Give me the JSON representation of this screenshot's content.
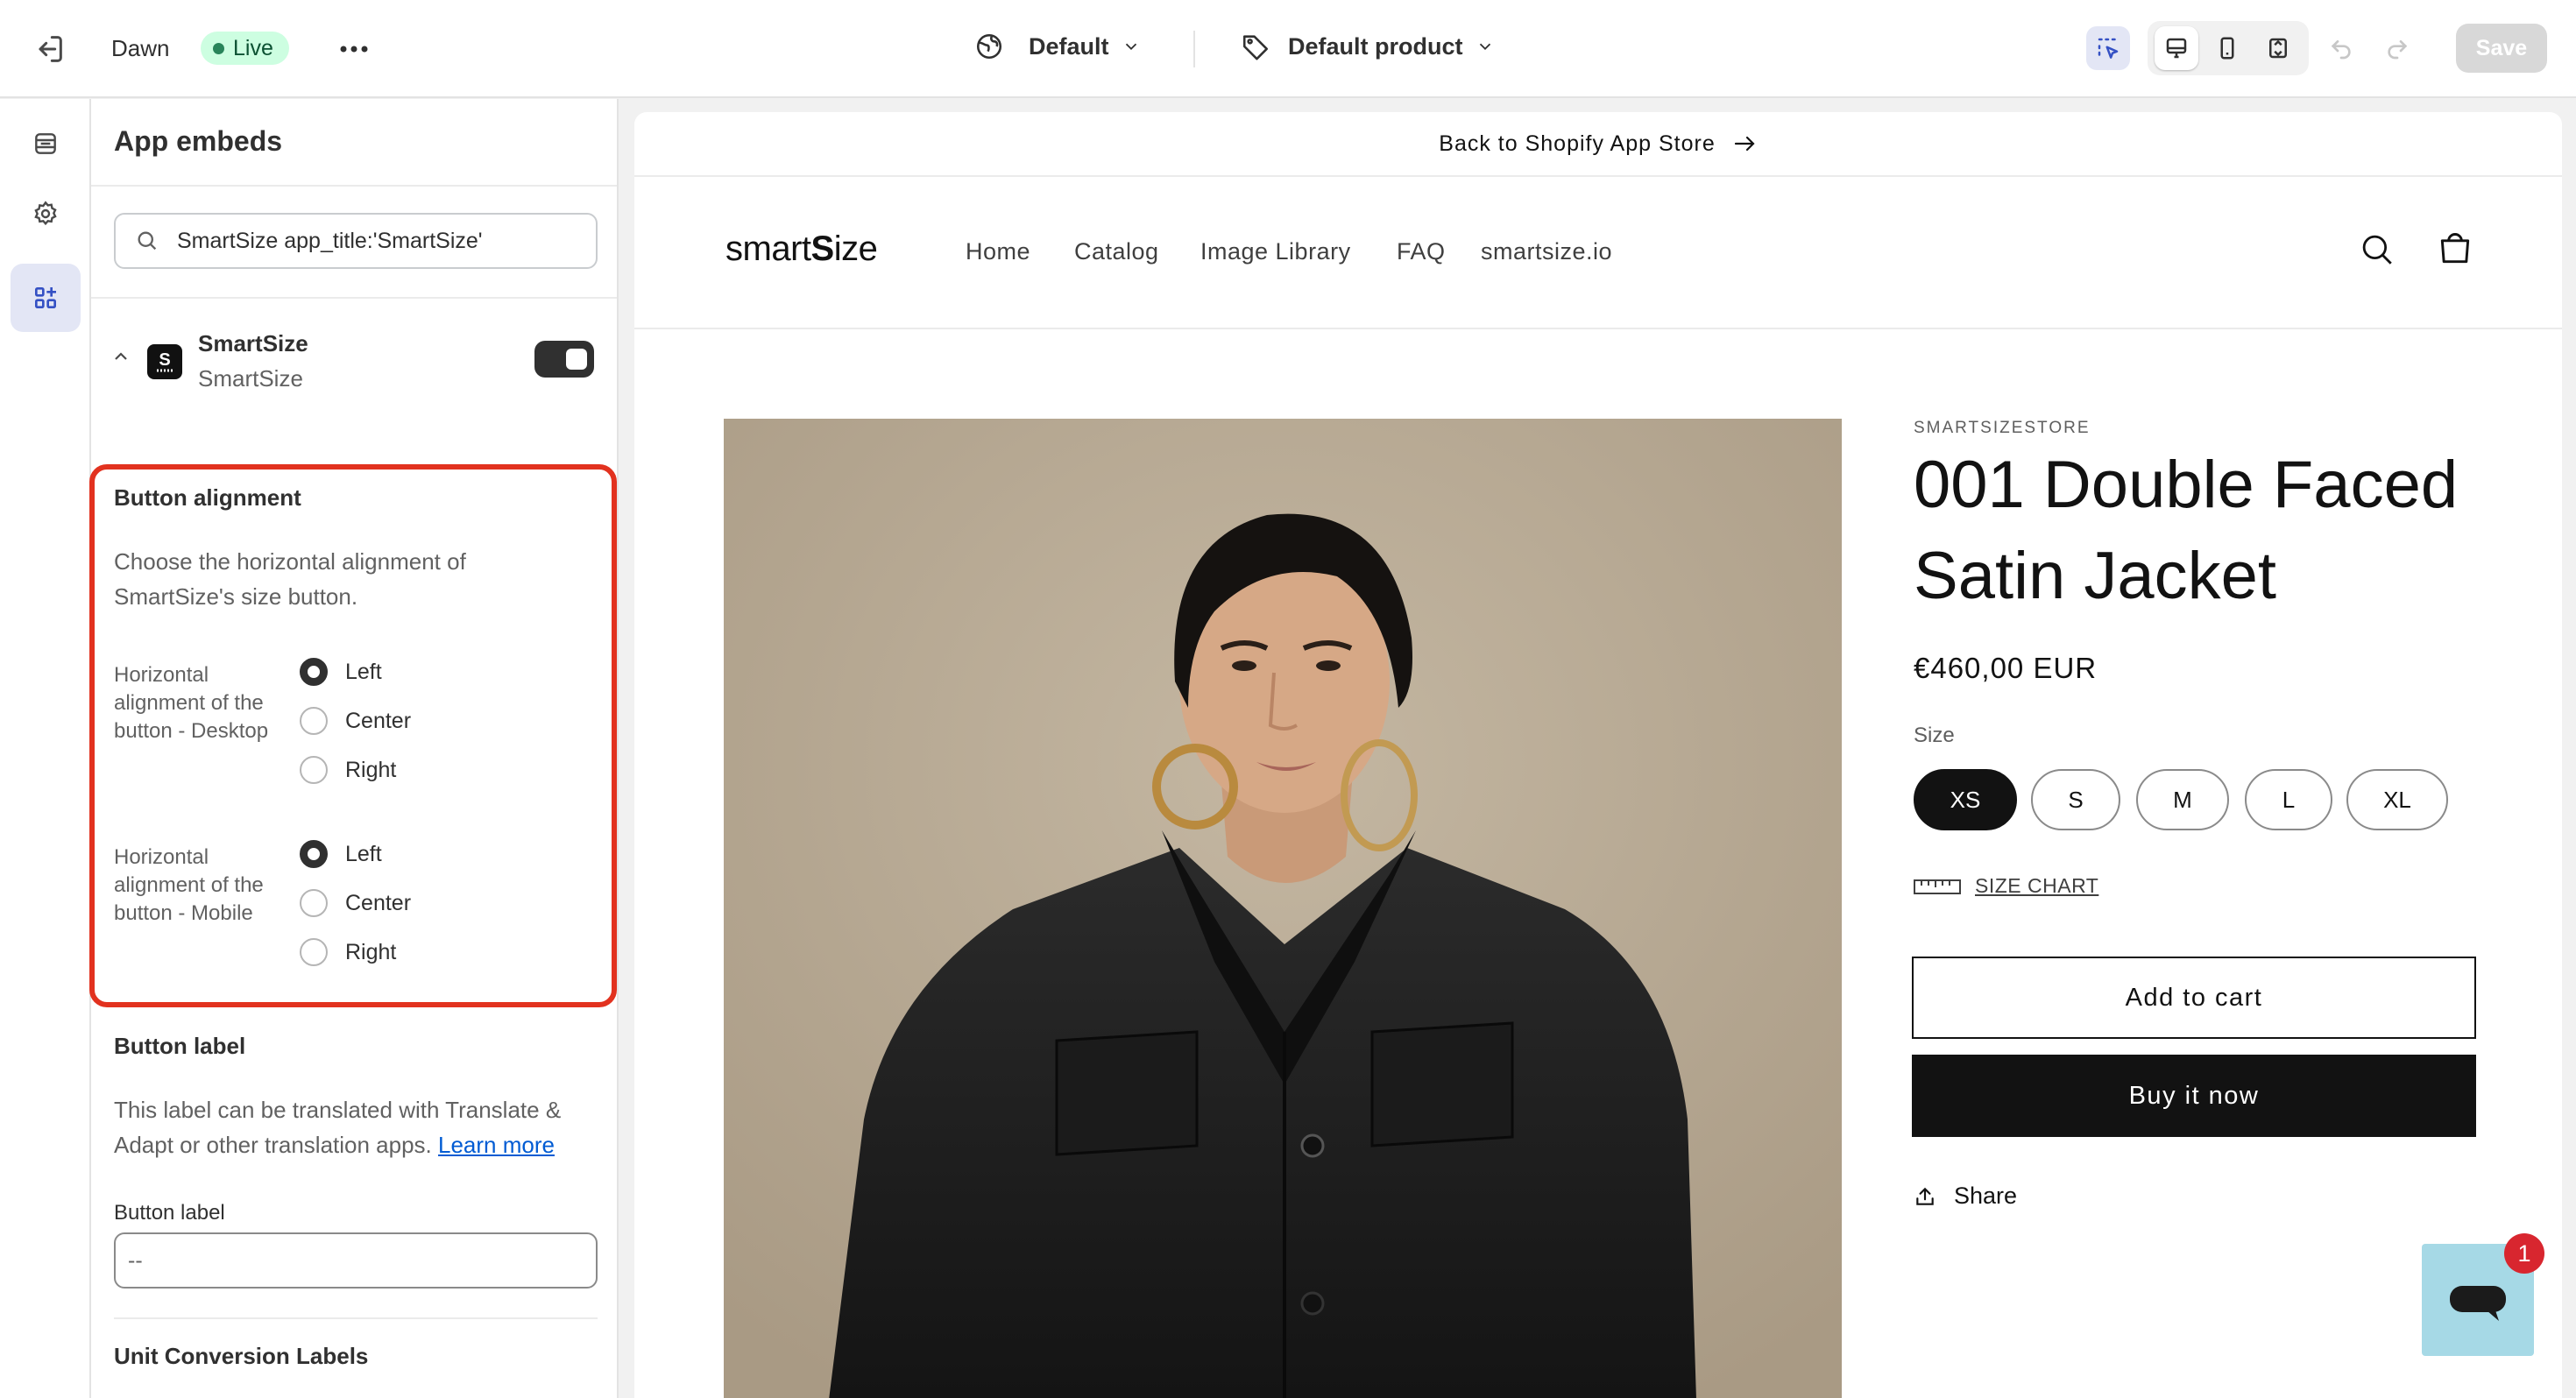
{
  "topbar": {
    "theme_name": "Dawn",
    "live_badge": "Live",
    "more_icon": "ellipsis-icon",
    "template_select": "Default",
    "product_select": "Default product",
    "save_label": "Save"
  },
  "sidebar": {
    "title": "App embeds",
    "search_value": "SmartSize app_title:'SmartSize'",
    "app": {
      "name": "SmartSize",
      "provider": "SmartSize",
      "enabled": true
    },
    "button_alignment": {
      "title": "Button alignment",
      "description": "Choose the horizontal alignment of SmartSize's size button.",
      "desktop": {
        "label": "Horizontal alignment of the button - Desktop",
        "options": [
          "Left",
          "Center",
          "Right"
        ],
        "selected": "Left"
      },
      "mobile": {
        "label": "Horizontal alignment of the button - Mobile",
        "options": [
          "Left",
          "Center",
          "Right"
        ],
        "selected": "Left"
      }
    },
    "button_label": {
      "title": "Button label",
      "description": "This label can be translated with Translate & Adapt or other translation apps.",
      "learn_more": "Learn more",
      "field_label": "Button label",
      "field_value": "--"
    },
    "unit_conversion_title": "Unit Conversion Labels"
  },
  "preview": {
    "announcement": "Back to Shopify App Store",
    "logo": {
      "prefix": "smart",
      "bold": "S",
      "suffix": "ize"
    },
    "nav": [
      "Home",
      "Catalog",
      "Image Library",
      "FAQ",
      "smartsize.io"
    ],
    "product": {
      "vendor": "SMARTSIZESTORE",
      "title": "001 Double Faced Satin Jacket",
      "price": "€460,00 EUR",
      "size_label": "Size",
      "sizes": [
        "XS",
        "S",
        "M",
        "L",
        "XL"
      ],
      "selected_size": "XS",
      "size_chart": "SIZE CHART",
      "add_to_cart": "Add to cart",
      "buy_now": "Buy it now",
      "share": "Share"
    },
    "chat_badge": "1"
  },
  "colors": {
    "highlight_border": "#e2321f",
    "live_badge_bg": "#cdfee1",
    "live_dot": "#29845a",
    "link": "#005bd3",
    "chat_bg": "#a6d9e6",
    "badge_bg": "#d8262f"
  }
}
